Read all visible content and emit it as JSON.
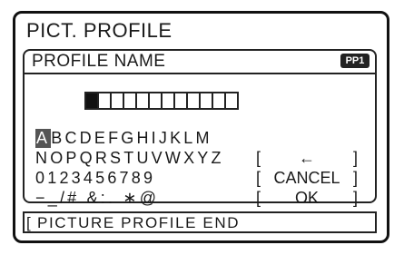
{
  "screen": {
    "title": "PICT. PROFILE",
    "panel": {
      "header_label": "PROFILE NAME",
      "header_icon": "PP1",
      "name_box_count": 12
    },
    "keyboard": {
      "rows": [
        [
          "A",
          "B",
          "C",
          "D",
          "E",
          "F",
          "G",
          "H",
          "I",
          "J",
          "K",
          "L",
          "M"
        ],
        [
          "N",
          "O",
          "P",
          "Q",
          "R",
          "S",
          "T",
          "U",
          "V",
          "W",
          "X",
          "Y",
          "Z"
        ],
        [
          "0",
          "1",
          "2",
          "3",
          "4",
          "5",
          "6",
          "7",
          "8",
          "9"
        ],
        [
          "−",
          "_",
          "/",
          "#",
          " ",
          "&",
          ":",
          ".",
          " ",
          "∗",
          "@"
        ]
      ],
      "selected": "A"
    },
    "buttons": {
      "left_bracket": "[",
      "right_bracket": "]",
      "backspace": "←",
      "cancel": "CANCEL",
      "ok": "OK"
    },
    "footer": {
      "left_bracket": "[",
      "text": "PICTURE PROFILE END"
    }
  }
}
